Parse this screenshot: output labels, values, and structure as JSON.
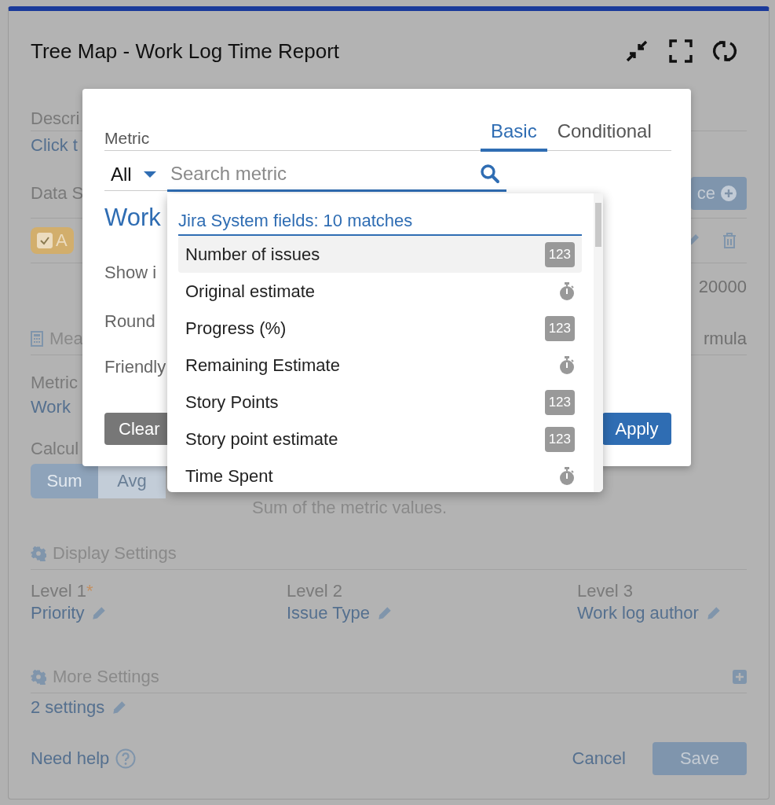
{
  "panel": {
    "title": "Tree Map - Work Log Time Report"
  },
  "background": {
    "description_label": "Descri",
    "description_link": "Click t",
    "data_source_label": "Data S",
    "data_source_button": "ce",
    "source_chip": {
      "label": "A",
      "checked": true
    },
    "limit_value": "20000",
    "measure_heading": "Mea",
    "formula_link": "rmula",
    "metric_label": "Metric",
    "metric_value": "Work",
    "calculation_label": "Calcul",
    "calculation_options": [
      {
        "label": "Sum",
        "selected": true
      },
      {
        "label": "Avg",
        "selected": false
      }
    ],
    "calculation_hint": "Sum of the metric values."
  },
  "display_settings": {
    "title": "Display Settings",
    "levels": [
      {
        "label": "Level 1",
        "required_mark": "*",
        "value": "Priority"
      },
      {
        "label": "Level 2",
        "value": "Issue Type"
      },
      {
        "label": "Level 3",
        "value": "Work log author"
      }
    ]
  },
  "more_settings": {
    "title": "More Settings",
    "summary": "2 settings"
  },
  "footer": {
    "help": "Need help",
    "cancel": "Cancel",
    "save": "Save"
  },
  "metric_popup": {
    "label": "Metric",
    "tabs": [
      {
        "label": "Basic",
        "selected": true
      },
      {
        "label": "Conditional",
        "selected": false
      }
    ],
    "type_filter": "All",
    "search": {
      "placeholder": "Search metric"
    },
    "selected_metric": "Work",
    "options": [
      "Show i",
      "Round",
      "Friendly"
    ],
    "clear": "Clear",
    "apply": "Apply"
  },
  "metric_dropdown": {
    "group": "Jira System fields: 10 matches",
    "items": [
      {
        "label": "Number of issues",
        "kind": "number",
        "badge": "123",
        "selected": true
      },
      {
        "label": "Original estimate",
        "kind": "time",
        "selected": false
      },
      {
        "label": "Progress (%)",
        "kind": "number",
        "badge": "123",
        "selected": false
      },
      {
        "label": "Remaining Estimate",
        "kind": "time",
        "selected": false
      },
      {
        "label": "Story Points",
        "kind": "number",
        "badge": "123",
        "selected": false
      },
      {
        "label": "Story point estimate",
        "kind": "number",
        "badge": "123",
        "selected": false
      },
      {
        "label": "Time Spent",
        "kind": "time",
        "selected": false
      }
    ]
  }
}
